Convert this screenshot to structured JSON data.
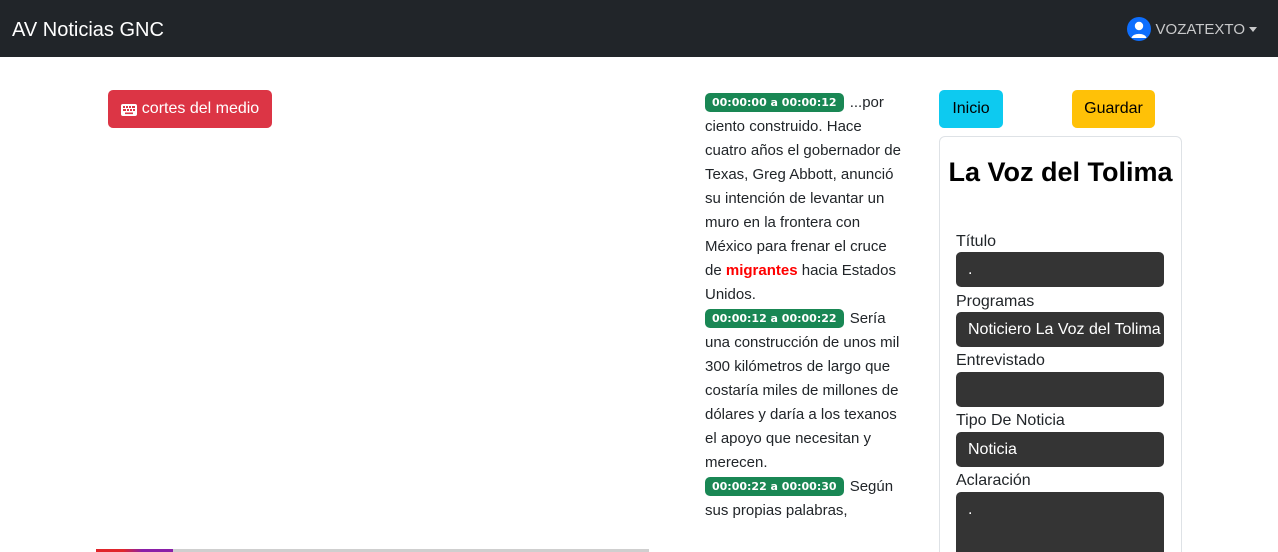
{
  "navbar": {
    "brand": "AV Noticias GNC",
    "user_name": "VOZATEXTO"
  },
  "player": {
    "cortes_label": "cortes del medio",
    "progress_fraction": 0.14
  },
  "transcript": [
    {
      "time": "00:00:00 a 00:00:12",
      "text_before": "...por ciento construido. Hace cuatro años el gobernador de Texas, Greg Abbott, anunció su intención de levantar un muro en la frontera con México para frenar el cruce de ",
      "highlight": "migrantes",
      "text_after": " hacia Estados Unidos."
    },
    {
      "time": "00:00:12 a 00:00:22",
      "text_before": "Sería una construcción de unos mil 300 kilómetros de largo que costaría miles de millones de dólares y daría a los texanos el apoyo que necesitan y merecen.",
      "highlight": "",
      "text_after": ""
    },
    {
      "time": "00:00:22 a 00:00:30",
      "text_before": "Según sus propias palabras,",
      "highlight": "",
      "text_after": ""
    }
  ],
  "actions": {
    "inicio_label": "Inicio",
    "guardar_label": "Guardar"
  },
  "form": {
    "title": "La Voz del Tolima",
    "titulo_label": "Título",
    "titulo_value": ".",
    "programas_label": "Programas",
    "programas_value": "Noticiero La Voz del Tolima",
    "entrevistado_label": "Entrevistado",
    "entrevistado_value": "",
    "tipo_label": "Tipo De Noticia",
    "tipo_value": "Noticia",
    "aclaracion_label": "Aclaración",
    "aclaracion_value": "."
  },
  "colors": {
    "navbar": "#212529",
    "danger": "#dc3545",
    "info": "#0dcaf0",
    "warning": "#ffc107",
    "success": "#198754",
    "highlight": "#ff0000",
    "field_bg": "#343434"
  },
  "icons": {
    "user": "user-circle-icon",
    "keyboard": "keyboard-icon",
    "caret": "caret-down-icon"
  }
}
